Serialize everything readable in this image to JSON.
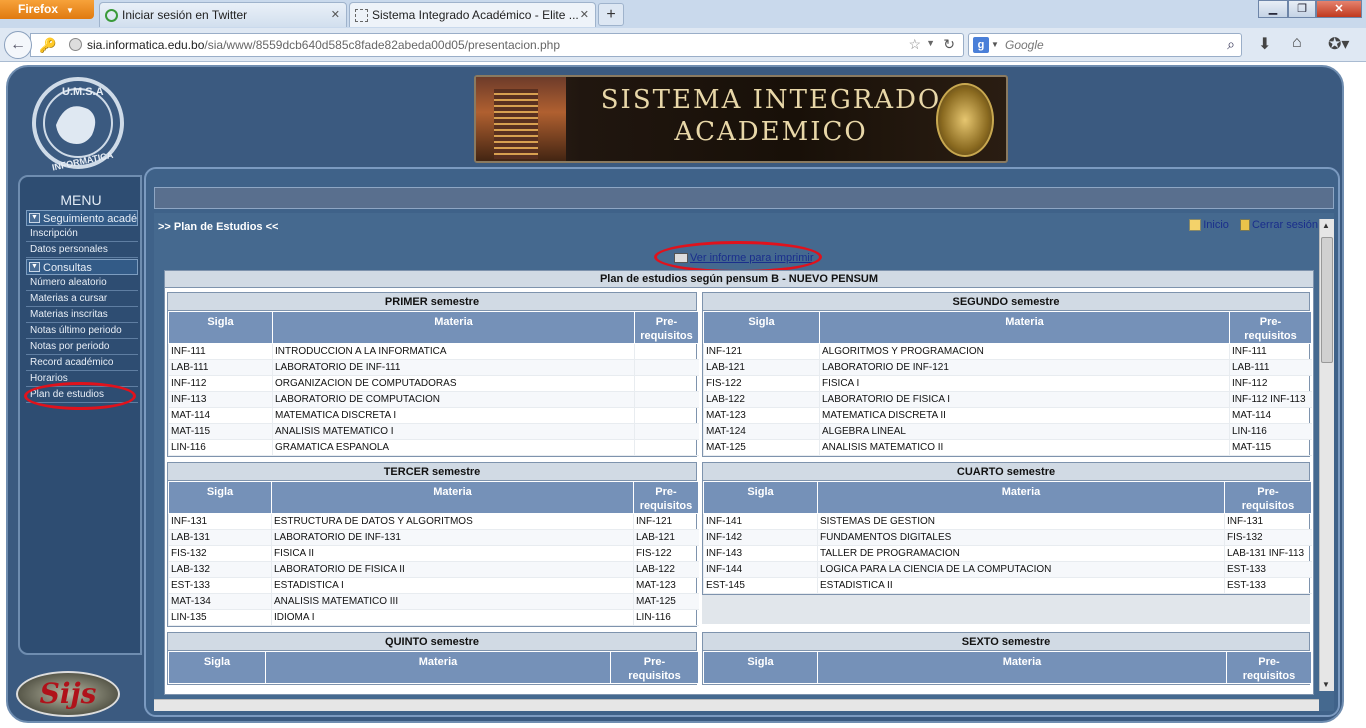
{
  "browser": {
    "app_button": "Firefox",
    "tabs": [
      {
        "title": "Iniciar sesión en Twitter"
      },
      {
        "title": "Sistema Integrado Académico - Elite ..."
      }
    ],
    "url_host": "sia.informatica.edu.bo",
    "url_path": "/sia/www/8559dcb640d585c8fade82abeda00d05/presentacion.php",
    "search_placeholder": "Google"
  },
  "banner": {
    "line1": "SISTEMA INTEGRADO",
    "line2": "ACADEMICO"
  },
  "logos": {
    "umsa": "U.M.S.A. INFORMATICA",
    "sijs": "Sijs"
  },
  "sidebar": {
    "title": "MENU",
    "group1": "Seguimiento acadé",
    "items1": [
      "Inscripción",
      "Datos personales"
    ],
    "group2": "Consultas",
    "items2": [
      "Número aleatorio",
      "Materias a cursar",
      "Materias inscritas",
      "Notas último periodo",
      "Notas por periodo",
      "Record académico",
      "Horarios",
      "Plan de estudios"
    ]
  },
  "content": {
    "breadcrumb": ">> Plan de Estudios <<",
    "inicio": "Inicio",
    "cerrar": "Cerrar sesión",
    "print_link": "Ver informe para imprimir",
    "plan_title": "Plan de estudios según pensum B - NUEVO PENSUM"
  },
  "headers": {
    "sigla": "Sigla",
    "materia": "Materia",
    "pre1": "Pre-",
    "pre2": "requisitos"
  },
  "semesters": [
    {
      "title": "PRIMER semestre",
      "rows": [
        [
          "INF-111",
          "INTRODUCCION A LA INFORMATICA",
          ""
        ],
        [
          "LAB-111",
          "LABORATORIO DE INF-111",
          ""
        ],
        [
          "INF-112",
          "ORGANIZACION DE COMPUTADORAS",
          ""
        ],
        [
          "INF-113",
          "LABORATORIO DE COMPUTACION",
          ""
        ],
        [
          "MAT-114",
          "MATEMATICA DISCRETA I",
          ""
        ],
        [
          "MAT-115",
          "ANALISIS MATEMATICO I",
          ""
        ],
        [
          "LIN-116",
          "GRAMATICA ESPANOLA",
          ""
        ]
      ]
    },
    {
      "title": "SEGUNDO semestre",
      "rows": [
        [
          "INF-121",
          "ALGORITMOS Y PROGRAMACION",
          "INF-111"
        ],
        [
          "LAB-121",
          "LABORATORIO DE INF-121",
          "LAB-111"
        ],
        [
          "FIS-122",
          "FISICA I",
          "INF-112"
        ],
        [
          "LAB-122",
          "LABORATORIO DE FISICA I",
          "INF-112 INF-113"
        ],
        [
          "MAT-123",
          "MATEMATICA DISCRETA II",
          "MAT-114"
        ],
        [
          "MAT-124",
          "ALGEBRA LINEAL",
          "LIN-116"
        ],
        [
          "MAT-125",
          "ANALISIS MATEMATICO II",
          "MAT-115"
        ]
      ]
    },
    {
      "title": "TERCER semestre",
      "rows": [
        [
          "INF-131",
          "ESTRUCTURA DE DATOS Y ALGORITMOS",
          "INF-121"
        ],
        [
          "LAB-131",
          "LABORATORIO DE INF-131",
          "LAB-121"
        ],
        [
          "FIS-132",
          "FISICA II",
          "FIS-122"
        ],
        [
          "LAB-132",
          "LABORATORIO DE FISICA II",
          "LAB-122"
        ],
        [
          "EST-133",
          "ESTADISTICA I",
          "MAT-123"
        ],
        [
          "MAT-134",
          "ANALISIS MATEMATICO III",
          "MAT-125"
        ],
        [
          "LIN-135",
          "IDIOMA I",
          "LIN-116"
        ]
      ]
    },
    {
      "title": "CUARTO semestre",
      "rows": [
        [
          "INF-141",
          "SISTEMAS DE GESTION",
          "INF-131"
        ],
        [
          "INF-142",
          "FUNDAMENTOS DIGITALES",
          "FIS-132"
        ],
        [
          "INF-143",
          "TALLER DE PROGRAMACION",
          "LAB-131 INF-113"
        ],
        [
          "INF-144",
          "LOGICA PARA LA CIENCIA DE LA COMPUTACION",
          "EST-133"
        ],
        [
          "EST-145",
          "ESTADISTICA II",
          "EST-133"
        ]
      ]
    },
    {
      "title": "QUINTO semestre",
      "rows": []
    },
    {
      "title": "SEXTO semestre",
      "rows": []
    }
  ]
}
